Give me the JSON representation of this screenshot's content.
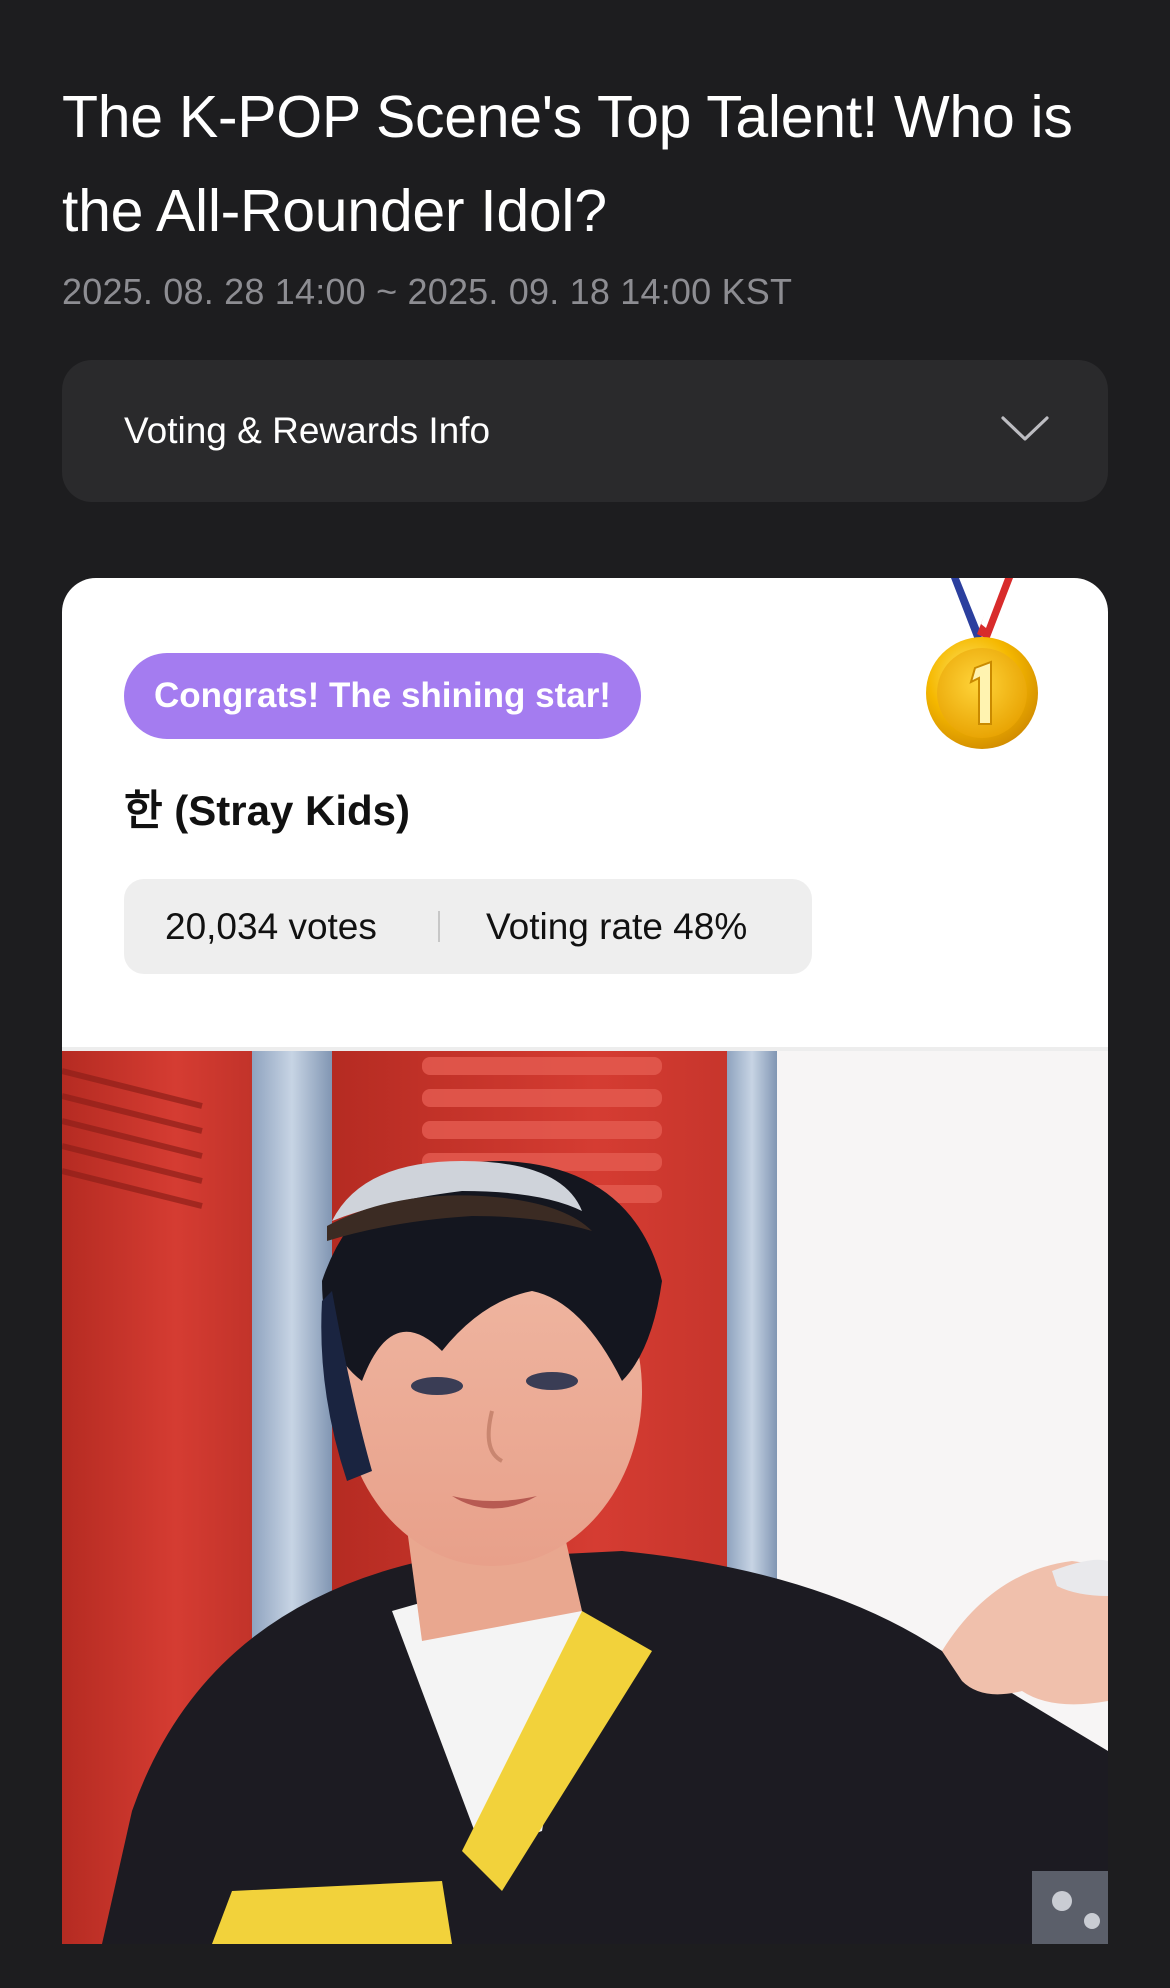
{
  "header": {
    "title": "The K-POP Scene's Top Talent! Who is the All-Rounder Idol?",
    "date_range": "2025. 08. 28 14:00 ~ 2025. 09. 18 14:00 KST"
  },
  "info_accordion": {
    "label": "Voting & Rewards Info",
    "icon": "chevron-down-icon"
  },
  "winner_card": {
    "badge": "Congrats! The shining star!",
    "medal_icon": "gold-medal-first-place-icon",
    "artist": "한 (Stray Kids)",
    "votes": "20,034 votes",
    "voting_rate": "Voting rate 48%",
    "photo": "artist-photo",
    "colors": {
      "badge": "#a47cf0",
      "card": "#ffffff",
      "stats_bg": "#eeeeee"
    }
  },
  "theme": {
    "background": "#1d1d1f",
    "panel": "#2a2a2c",
    "muted_text": "#8d8d92"
  }
}
